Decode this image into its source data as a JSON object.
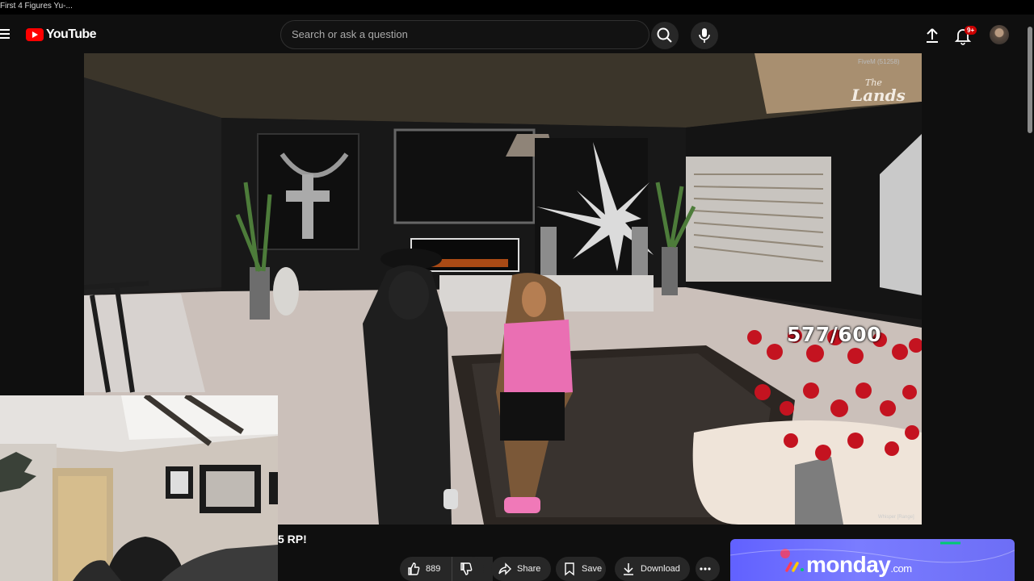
{
  "browser": {
    "tab_title": "First 4 Figures Yu-..."
  },
  "header": {
    "brand": "YouTube",
    "search_placeholder": "Search or ask a question",
    "notification_count": "9+"
  },
  "video": {
    "fps_readout": "FiveM (51258)",
    "watermark_the": "The",
    "watermark_lands": "Lands",
    "hp_counter": "577/600",
    "range_label": "Whisper [Range]",
    "title_partial": "5 RP!"
  },
  "actions": {
    "like_count": "889",
    "share_label": "Share",
    "save_label": "Save",
    "download_label": "Download"
  },
  "ad": {
    "brand": "monday",
    "tld": ".com"
  },
  "colors": {
    "accent": "#ff0000",
    "ad_bg": "#6161ff",
    "badge": "#cc0000"
  }
}
